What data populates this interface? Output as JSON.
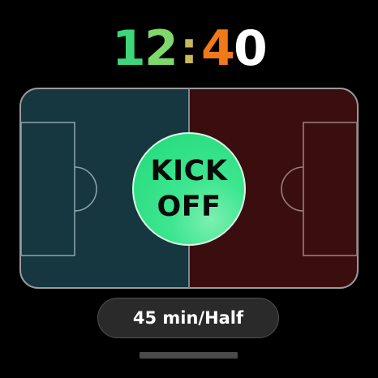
{
  "clock": {
    "digit1": "1",
    "digit2": "2",
    "separator": ":",
    "digit3": "4",
    "digit4": "0",
    "colors": {
      "home": "#3ed67a",
      "home_light": "#7fe07f",
      "separator": "#c8c06a",
      "away": "#f07a1a",
      "away_light": "#ffffff"
    }
  },
  "pitch": {
    "home_color": "#163640",
    "away_color": "#3a0d0f",
    "line_color": "#9a9a9a"
  },
  "kickoff_button": {
    "line1": "KICK",
    "line2": "OFF"
  },
  "duration_button": {
    "label": "45 min/Half"
  }
}
